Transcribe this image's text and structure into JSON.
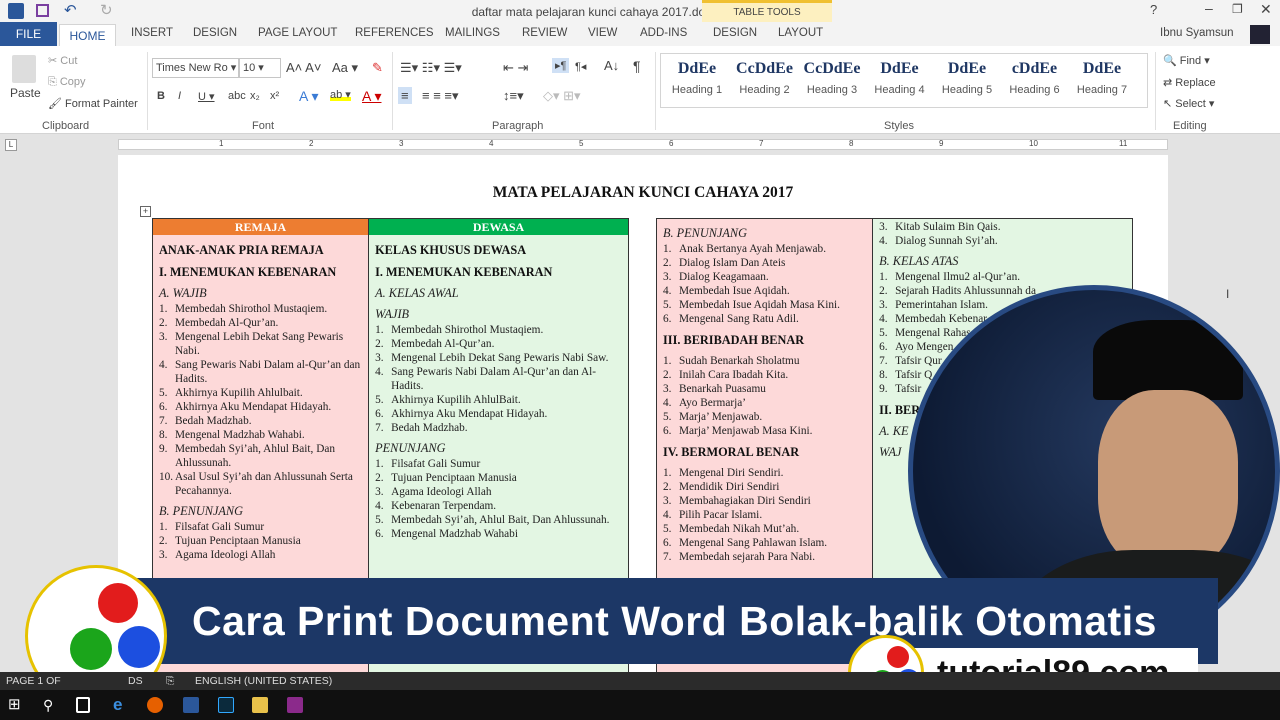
{
  "window": {
    "title": "daftar mata pelajaran kunci cahaya 2017.docx - Microsoft Word",
    "user": "Ibnu Syamsun",
    "context_group": "TABLE TOOLS"
  },
  "tabs": [
    "FILE",
    "HOME",
    "INSERT",
    "DESIGN",
    "PAGE LAYOUT",
    "REFERENCES",
    "MAILINGS",
    "REVIEW",
    "VIEW",
    "ADD-INS",
    "DESIGN",
    "LAYOUT"
  ],
  "ribbon": {
    "clipboard": {
      "paste": "Paste",
      "cut": "Cut",
      "copy": "Copy",
      "format_painter": "Format Painter",
      "label": "Clipboard"
    },
    "font": {
      "name": "Times New Ro",
      "size": "10",
      "label": "Font"
    },
    "paragraph": {
      "label": "Paragraph"
    },
    "styles": {
      "label": "Styles",
      "items": [
        {
          "sample": "DdEe",
          "name": "Heading 1"
        },
        {
          "sample": "CcDdEe",
          "name": "Heading 2"
        },
        {
          "sample": "CcDdEe",
          "name": "Heading 3"
        },
        {
          "sample": "DdEe",
          "name": "Heading 4"
        },
        {
          "sample": "DdEe",
          "name": "Heading 5"
        },
        {
          "sample": "cDdEe",
          "name": "Heading 6"
        },
        {
          "sample": "DdEe",
          "name": "Heading 7"
        }
      ]
    },
    "editing": {
      "find": "Find",
      "replace": "Replace",
      "select": "Select",
      "label": "Editing"
    }
  },
  "ruler": {
    "ticks": [
      "1",
      "2",
      "3",
      "4",
      "5",
      "6",
      "7",
      "8",
      "9",
      "10",
      "11"
    ]
  },
  "document": {
    "title": "MATA PELAJARAN KUNCI CAHAYA 2017",
    "table1": {
      "headers": [
        "REMAJA",
        "DEWASA"
      ],
      "header_colors": [
        "#ed7d31",
        "#00b050"
      ],
      "col1": [
        [
          "h",
          "ANAK-ANAK PRIA REMAJA"
        ],
        [
          "h",
          "I. MENEMUKAN KEBENARAN"
        ],
        [
          "sub",
          "A. WAJIB"
        ],
        [
          "li",
          "1.",
          "Membedah Shirothol Mustaqiem."
        ],
        [
          "li",
          "2.",
          "Membedah Al-Qur’an."
        ],
        [
          "li",
          "3.",
          "Mengenal Lebih Dekat Sang Pewaris Nabi."
        ],
        [
          "li",
          "4.",
          "Sang Pewaris Nabi Dalam al-Qur’an dan Hadits."
        ],
        [
          "li",
          "5.",
          "Akhirnya Kupilih Ahlulbait."
        ],
        [
          "li",
          "6.",
          "Akhirnya Aku Mendapat Hidayah."
        ],
        [
          "li",
          "7.",
          "Bedah Madzhab."
        ],
        [
          "li",
          "8.",
          "Mengenal Madzhab Wahabi."
        ],
        [
          "li",
          "9.",
          "Membedah Syi’ah, Ahlul Bait, Dan Ahlussunah."
        ],
        [
          "li",
          "10.",
          "Asal Usul Syi’ah dan Ahlussunah Serta Pecahannya."
        ],
        [
          "sub",
          "B. PENUNJANG"
        ],
        [
          "li",
          "1.",
          "Filsafat Gali Sumur"
        ],
        [
          "li",
          "2.",
          "Tujuan Penciptaan Manusia"
        ],
        [
          "li",
          "3.",
          "Agama Ideologi Allah"
        ]
      ],
      "col2": [
        [
          "h",
          "KELAS KHUSUS DEWASA"
        ],
        [
          "h",
          "I. MENEMUKAN KEBENARAN"
        ],
        [
          "sub",
          "A. KELAS AWAL"
        ],
        [
          "sub",
          "WAJIB"
        ],
        [
          "li",
          "1.",
          "Membedah Shirothol Mustaqiem."
        ],
        [
          "li",
          "2.",
          "Membedah Al-Qur’an."
        ],
        [
          "li",
          "3.",
          "Mengenal Lebih Dekat Sang Pewaris Nabi Saw."
        ],
        [
          "li",
          "4.",
          "Sang Pewaris Nabi Dalam Al-Qur’an dan Al-Hadits."
        ],
        [
          "li",
          "5.",
          "Akhirnya Kupilih AhlulBait."
        ],
        [
          "li",
          "6.",
          "Akhirnya Aku Mendapat Hidayah."
        ],
        [
          "li",
          "7.",
          "Bedah Madzhab."
        ],
        [
          "sub",
          "PENUNJANG"
        ],
        [
          "li",
          "1.",
          "Filsafat Gali Sumur"
        ],
        [
          "li",
          "2.",
          "Tujuan Penciptaan Manusia"
        ],
        [
          "li",
          "3.",
          "Agama Ideologi Allah"
        ],
        [
          "li",
          "4.",
          "Kebenaran Terpendam."
        ],
        [
          "li",
          "5.",
          "Membedah Syi’ah, Ahlul Bait, Dan Ahlussunah."
        ],
        [
          "li",
          "6.",
          "Mengenal Madzhab Wahabi"
        ]
      ]
    },
    "table2": {
      "col1": [
        [
          "sub",
          "B. PENUNJANG"
        ],
        [
          "li",
          "1.",
          "Anak Bertanya Ayah Menjawab."
        ],
        [
          "li",
          "2.",
          "Dialog Islam Dan Ateis"
        ],
        [
          "li",
          "3.",
          "Dialog Keagamaan."
        ],
        [
          "li",
          "4.",
          "Membedah Isue Aqidah."
        ],
        [
          "li",
          "5.",
          "Membedah Isue Aqidah Masa Kini."
        ],
        [
          "li",
          "6.",
          "Mengenal Sang Ratu Adil."
        ],
        [
          "h",
          "III. BERIBADAH BENAR"
        ],
        [
          "li",
          "1.",
          "Sudah Benarkah Sholatmu"
        ],
        [
          "li",
          "2.",
          "Inilah Cara Ibadah Kita."
        ],
        [
          "li",
          "3.",
          "Benarkah Puasamu"
        ],
        [
          "li",
          "4.",
          "Ayo Bermarja’"
        ],
        [
          "li",
          "5.",
          "Marja’ Menjawab."
        ],
        [
          "li",
          "6.",
          "Marja’ Menjawab Masa Kini."
        ],
        [
          "h",
          "IV. BERMORAL BENAR"
        ],
        [
          "li",
          "1.",
          "Mengenal Diri Sendiri."
        ],
        [
          "li",
          "2.",
          "Mendidik Diri Sendiri"
        ],
        [
          "li",
          "3.",
          "Membahagiakan Diri Sendiri"
        ],
        [
          "li",
          "4.",
          "Pilih Pacar Islami."
        ],
        [
          "li",
          "5.",
          "Membedah Nikah Mut’ah."
        ],
        [
          "li",
          "6.",
          "Mengenal Sang Pahlawan Islam."
        ],
        [
          "li",
          "7.",
          "Membedah sejarah Para Nabi."
        ]
      ],
      "col2": [
        [
          "li",
          "3.",
          "Kitab Sulaim Bin Qais."
        ],
        [
          "li",
          "4.",
          "Dialog Sunnah Syi’ah."
        ],
        [
          "sub",
          "B. KELAS ATAS"
        ],
        [
          "li",
          "1.",
          "Mengenal Ilmu2 al-Qur’an."
        ],
        [
          "li",
          "2.",
          "Sejarah Hadits Ahlussunnah da"
        ],
        [
          "li",
          "3.",
          "Pemerintahan Islam."
        ],
        [
          "li",
          "4.",
          "Membedah Kebenar"
        ],
        [
          "li",
          "5.",
          "Mengenal Rahas"
        ],
        [
          "li",
          "6.",
          "Ayo Mengen"
        ],
        [
          "li",
          "7.",
          "Tafsir Qur"
        ],
        [
          "li",
          "8.",
          "Tafsir Q"
        ],
        [
          "li",
          "9.",
          "Tafsir"
        ],
        [
          "h",
          "II. BER"
        ],
        [
          "sub",
          "A. KE"
        ],
        [
          "sub",
          "WAJ"
        ]
      ]
    }
  },
  "overlay": {
    "banner": "Cara Print Document Word Bolak-balik Otomatis",
    "url": "tutorial89.com"
  },
  "status": {
    "page": "PAGE 1 OF",
    "words": "DS",
    "language": "ENGLISH (UNITED STATES)"
  },
  "colors": {
    "word_blue": "#2b579a",
    "banner": "#1c3766",
    "remaja": "#ed7d31",
    "dewasa": "#00b050"
  }
}
